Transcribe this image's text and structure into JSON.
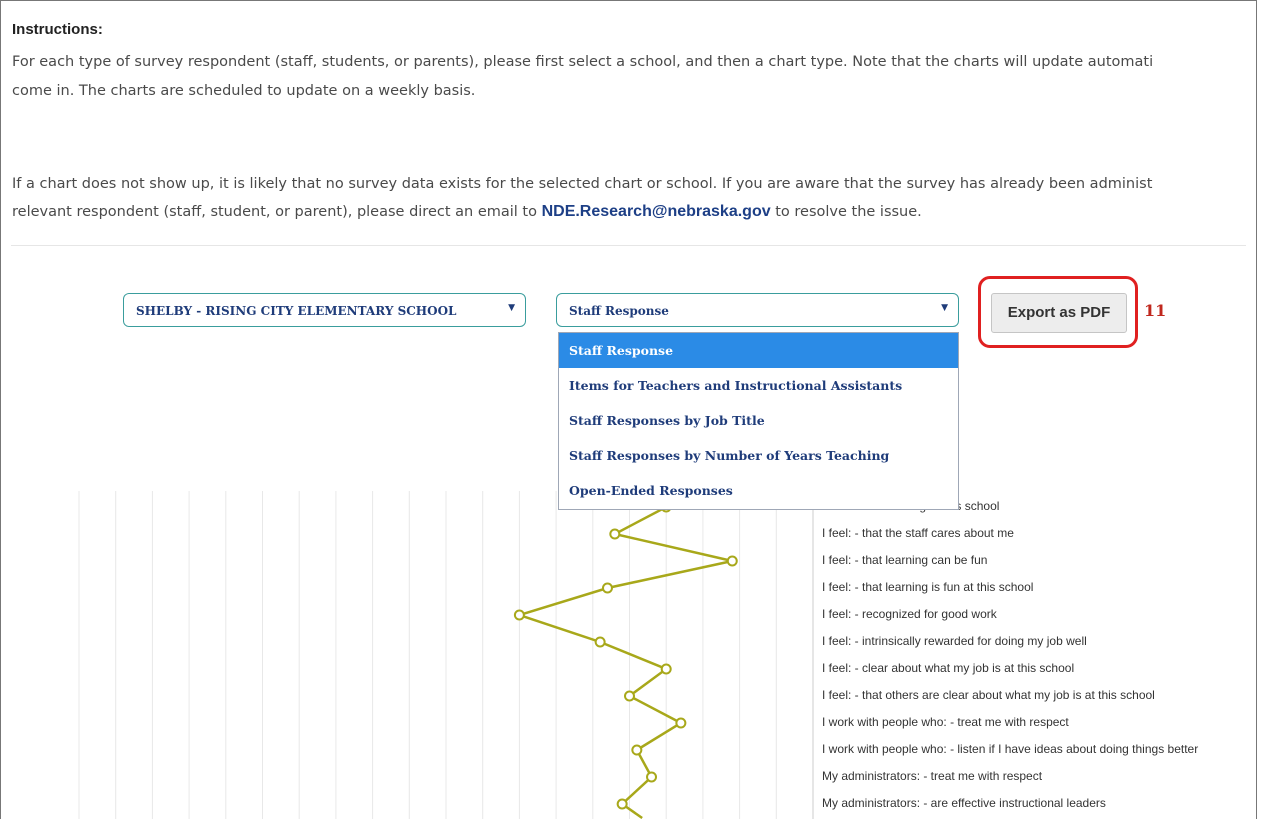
{
  "instructions": {
    "title": "Instructions:",
    "para1_line1": "For each type of survey respondent (staff, students, or parents), please first select a school, and then a chart type. Note that the charts will update automati",
    "para1_line2": "come in. The charts are scheduled to update on a weekly basis.",
    "para2_line1": "If a chart does not show up, it is likely that no survey data exists for the selected chart or school. If you are aware that the survey has already been administ",
    "para2_line2_before": "relevant respondent (staff, student, or parent), please direct an email to ",
    "email": "NDE.Research@nebraska.gov",
    "para2_line2_after": " to resolve the issue."
  },
  "controls": {
    "school_value": "SHELBY - RISING CITY ELEMENTARY SCHOOL",
    "chart_type_value": "Staff Response",
    "chart_type_options": [
      "Staff Response",
      "Items for Teachers and Instructional Assistants",
      "Staff Responses by Job Title",
      "Staff Responses by Number of Years Teaching",
      "Open-Ended Responses"
    ],
    "selected_option_index": 0,
    "export_label": "Export as PDF",
    "annotation_number": "11"
  },
  "icons": {
    "dropdown_arrow": "chevron-down-icon"
  },
  "colors": {
    "line": "#a8a81a",
    "accent": "#2b8be6",
    "annotation": "#e02020"
  },
  "chart_data": {
    "type": "line",
    "categories": [
      "I feel: - like I belong at this school",
      "I feel: - that the staff cares about me",
      "I feel: - that learning can be fun",
      "I feel: - that learning is fun at this school",
      "I feel: - recognized for good work",
      "I feel: - intrinsically rewarded for doing my job well",
      "I feel: - clear about what my job is at this school",
      "I feel: - that others are clear about what my job is at this school",
      "I work with people who: - treat me with respect",
      "I work with people who: - listen if I have ideas about doing things better",
      "My administrators: - treat me with respect",
      "My administrators: - are effective instructional leaders"
    ],
    "visible_labels": [
      "I feel: - like I belong at this school",
      "I feel: - that the staff cares about me",
      "I feel: - that learning can be fun",
      "I feel: - that learning is fun at this school",
      "I feel: - recognized for good work",
      "I feel: - intrinsically rewarded for doing my job well",
      "I feel: - clear about what my job is at this school",
      "I feel: - that others are clear about what my job is at this school",
      "I work with people who: - treat me with respect",
      "I work with people who: - listen if I have ideas about doing things better",
      "My administrators: - treat me with respect",
      "My administrators: - are effective instructional leaders"
    ],
    "values": [
      0.8,
      0.73,
      0.89,
      0.72,
      0.6,
      0.71,
      0.8,
      0.75,
      0.82,
      0.76,
      0.78,
      0.74
    ],
    "xlim": [
      0,
      1
    ],
    "grid": true
  }
}
